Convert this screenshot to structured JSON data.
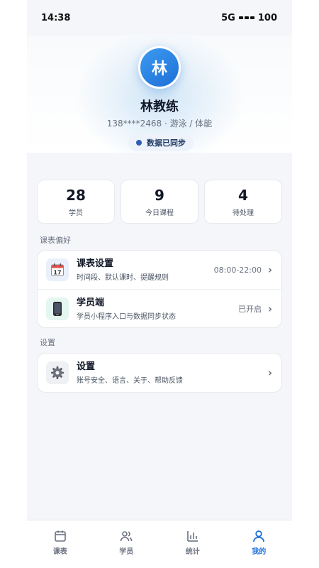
{
  "status_bar": {
    "time": "14:38",
    "network": "5G",
    "battery": "100"
  },
  "profile": {
    "avatar_char": "林",
    "name": "林教练",
    "subtitle": "138****2468 · 游泳 / 体能",
    "sync_status": "数据已同步"
  },
  "stats": [
    {
      "value": "28",
      "label": "学员"
    },
    {
      "value": "9",
      "label": "今日课程"
    },
    {
      "value": "4",
      "label": "待处理"
    }
  ],
  "section_preferences": {
    "title": "课表偏好",
    "items": [
      {
        "title": "课表设置",
        "desc": "时间段、默认课时、提醒规则",
        "value": "08:00-22:00",
        "icon": "calendar-icon",
        "icon_bg": "#e9f0fb"
      },
      {
        "title": "学员端",
        "desc": "学员小程序入口与数据同步状态",
        "value": "已开启",
        "icon": "phone-icon",
        "icon_bg": "#e3f6ef"
      }
    ]
  },
  "section_settings": {
    "title": "设置",
    "items": [
      {
        "title": "设置",
        "desc": "账号安全、语言、关于、帮助反馈",
        "value": "",
        "icon": "gear-icon",
        "icon_bg": "#eef0f4"
      }
    ]
  },
  "tabbar": {
    "items": [
      {
        "label": "课表",
        "icon": "calendar-icon",
        "active": false
      },
      {
        "label": "学员",
        "icon": "users-icon",
        "active": false
      },
      {
        "label": "统计",
        "icon": "bar-chart-icon",
        "active": false
      },
      {
        "label": "我的",
        "icon": "person-icon",
        "active": true
      }
    ],
    "active_color": "#1f6fd6",
    "inactive_color": "#6b7280"
  },
  "colors": {
    "accent": "#1f6fd6",
    "background": "#f4f6f9",
    "card": "#ffffff"
  }
}
